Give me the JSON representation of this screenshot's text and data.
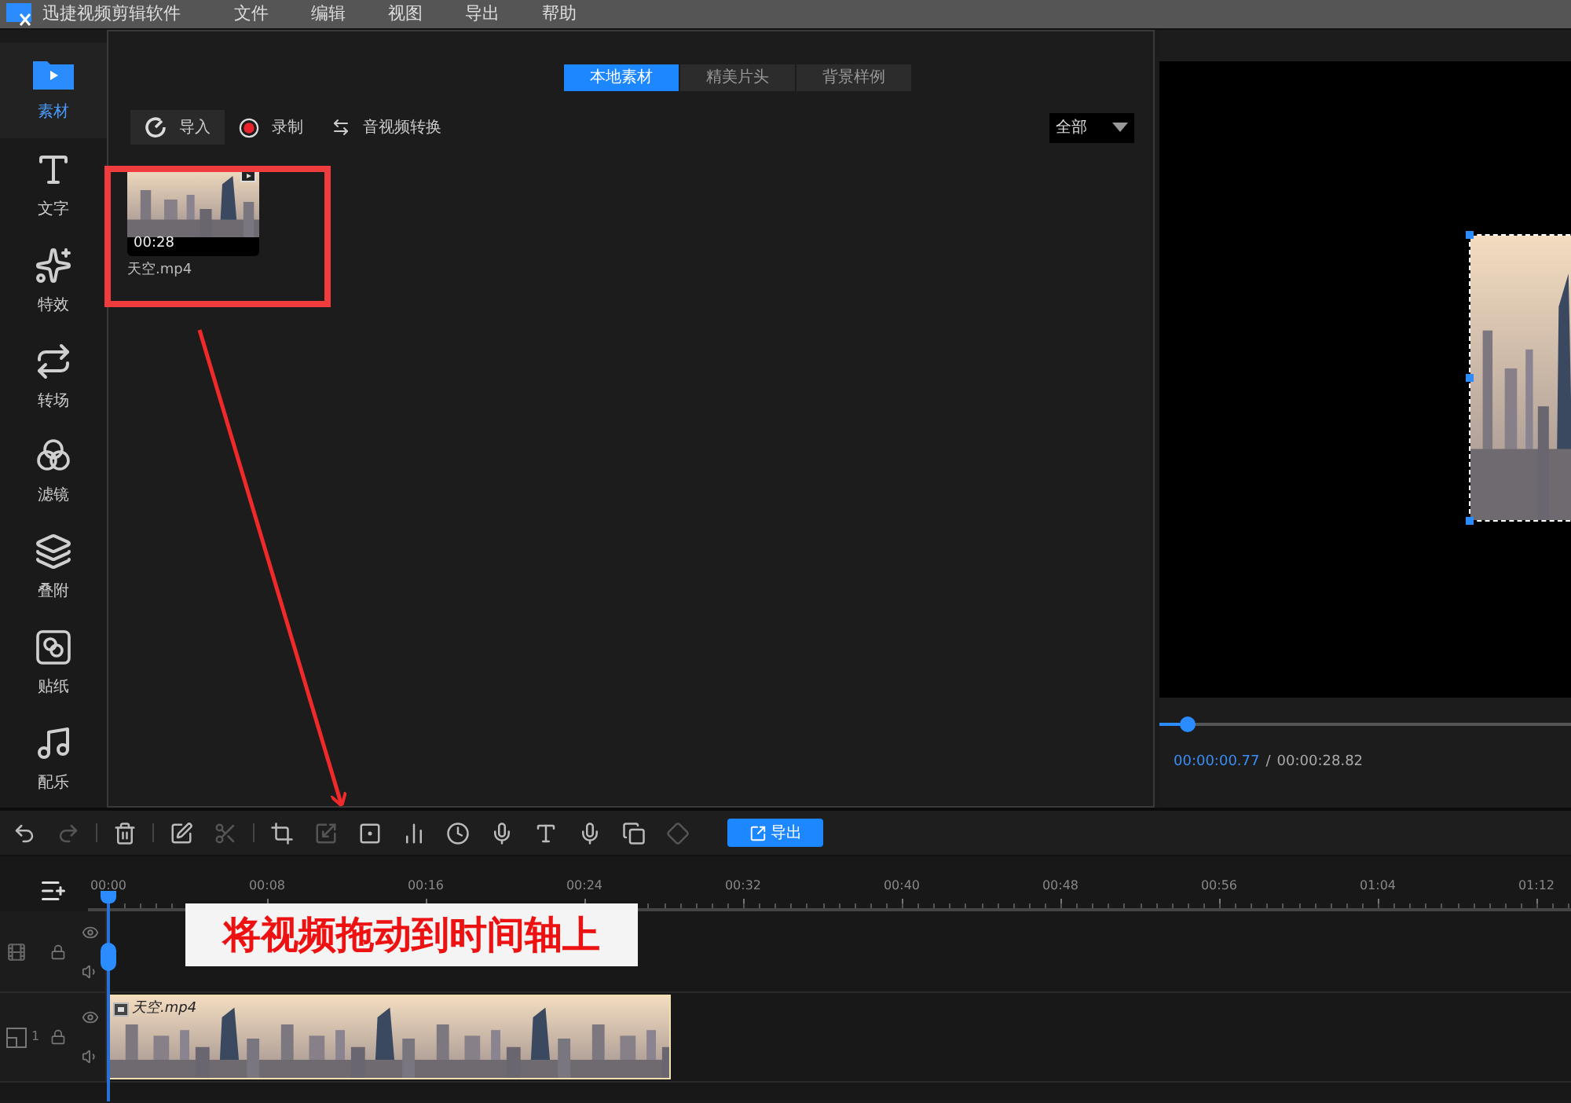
{
  "app": {
    "title": "迅捷视频剪辑软件"
  },
  "menu": [
    "文件",
    "编辑",
    "视图",
    "导出",
    "帮助"
  ],
  "sidebar": [
    {
      "kind": "media",
      "label": "素材",
      "selected": true
    },
    {
      "kind": "text",
      "label": "文字",
      "selected": false
    },
    {
      "kind": "effects",
      "label": "特效",
      "selected": false
    },
    {
      "kind": "transition",
      "label": "转场",
      "selected": false
    },
    {
      "kind": "filter",
      "label": "滤镜",
      "selected": false
    },
    {
      "kind": "overlay",
      "label": "叠附",
      "selected": false
    },
    {
      "kind": "sticker",
      "label": "贴纸",
      "selected": false
    },
    {
      "kind": "music",
      "label": "配乐",
      "selected": false
    }
  ],
  "library": {
    "tabs": [
      {
        "label": "本地素材",
        "selected": true
      },
      {
        "label": "精美片头",
        "selected": false
      },
      {
        "label": "背景样例",
        "selected": false
      }
    ],
    "actions": [
      {
        "kind": "import",
        "label": "导入",
        "selected": true
      },
      {
        "kind": "record",
        "label": "录制",
        "selected": false
      },
      {
        "kind": "convert",
        "label": "音视频转换",
        "selected": false
      }
    ],
    "filter": {
      "value": "全部"
    },
    "items": [
      {
        "name": "天空.mp4",
        "duration": "00:28"
      }
    ]
  },
  "preview": {
    "current_time": "00:00:00.77",
    "separator": "/",
    "total_time": "00:00:28.82",
    "level": 0.07
  },
  "toolbar": {
    "tools": [
      {
        "kind": "undo",
        "disabled": false
      },
      {
        "kind": "redo",
        "disabled": true
      },
      {
        "kind": "delete",
        "disabled": false
      },
      {
        "kind": "edit",
        "disabled": false
      },
      {
        "kind": "cut",
        "disabled": true
      },
      {
        "kind": "crop",
        "disabled": false
      },
      {
        "kind": "resize",
        "disabled": true
      },
      {
        "kind": "mosaic",
        "disabled": false
      },
      {
        "kind": "audio",
        "disabled": false
      },
      {
        "kind": "speed",
        "disabled": false
      },
      {
        "kind": "voice",
        "disabled": false
      },
      {
        "kind": "text-to-speech",
        "disabled": false
      },
      {
        "kind": "speech-to-text",
        "disabled": false
      },
      {
        "kind": "subtitle",
        "disabled": false
      },
      {
        "kind": "keyframe",
        "disabled": true
      }
    ],
    "export_label": "导出"
  },
  "timeline": {
    "ticks": [
      "00:00",
      "00:08",
      "00:16",
      "00:24",
      "00:32",
      "00:40",
      "00:48",
      "00:56",
      "01:04",
      "01:12"
    ],
    "tracks": [
      {
        "kind": "video"
      },
      {
        "kind": "overlay",
        "number": "1",
        "clip": "天空.mp4"
      }
    ]
  },
  "annotation": {
    "caption": "将视频拖动到时间轴上"
  }
}
